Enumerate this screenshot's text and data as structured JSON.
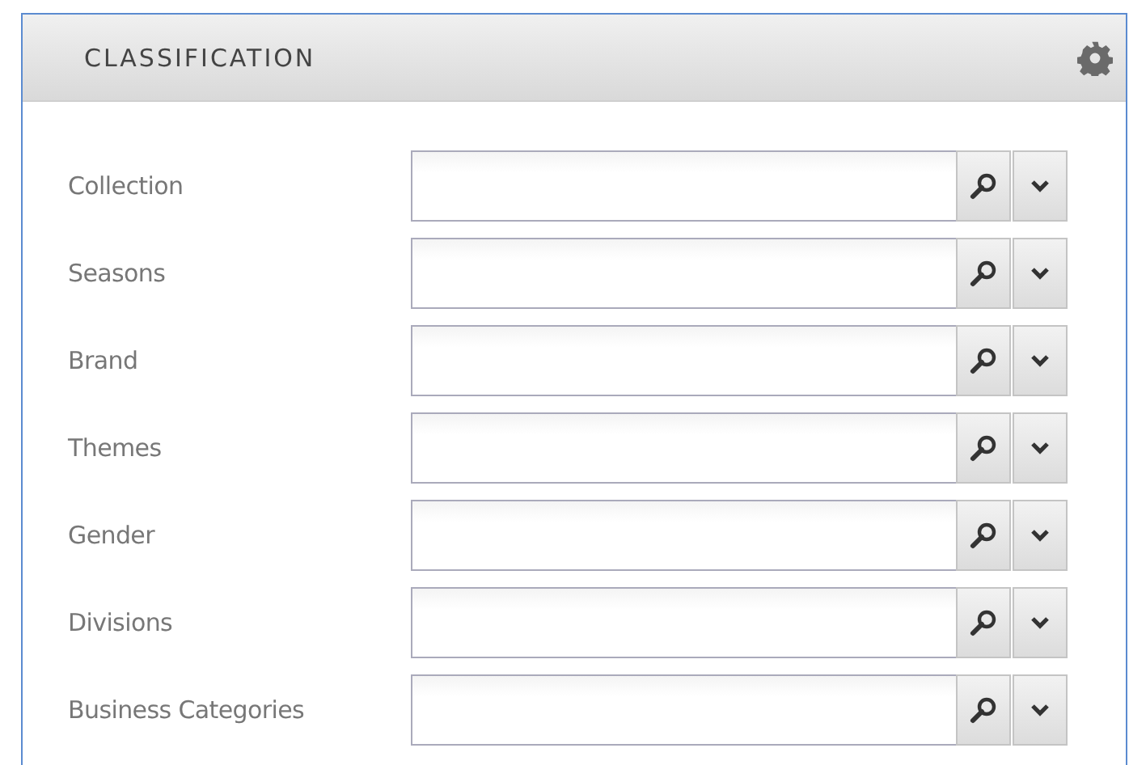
{
  "panel": {
    "title": "CLASSIFICATION"
  },
  "fields": [
    {
      "label": "Collection"
    },
    {
      "label": "Seasons"
    },
    {
      "label": "Brand"
    },
    {
      "label": "Themes"
    },
    {
      "label": "Gender"
    },
    {
      "label": "Divisions"
    },
    {
      "label": "Business Categories"
    }
  ]
}
